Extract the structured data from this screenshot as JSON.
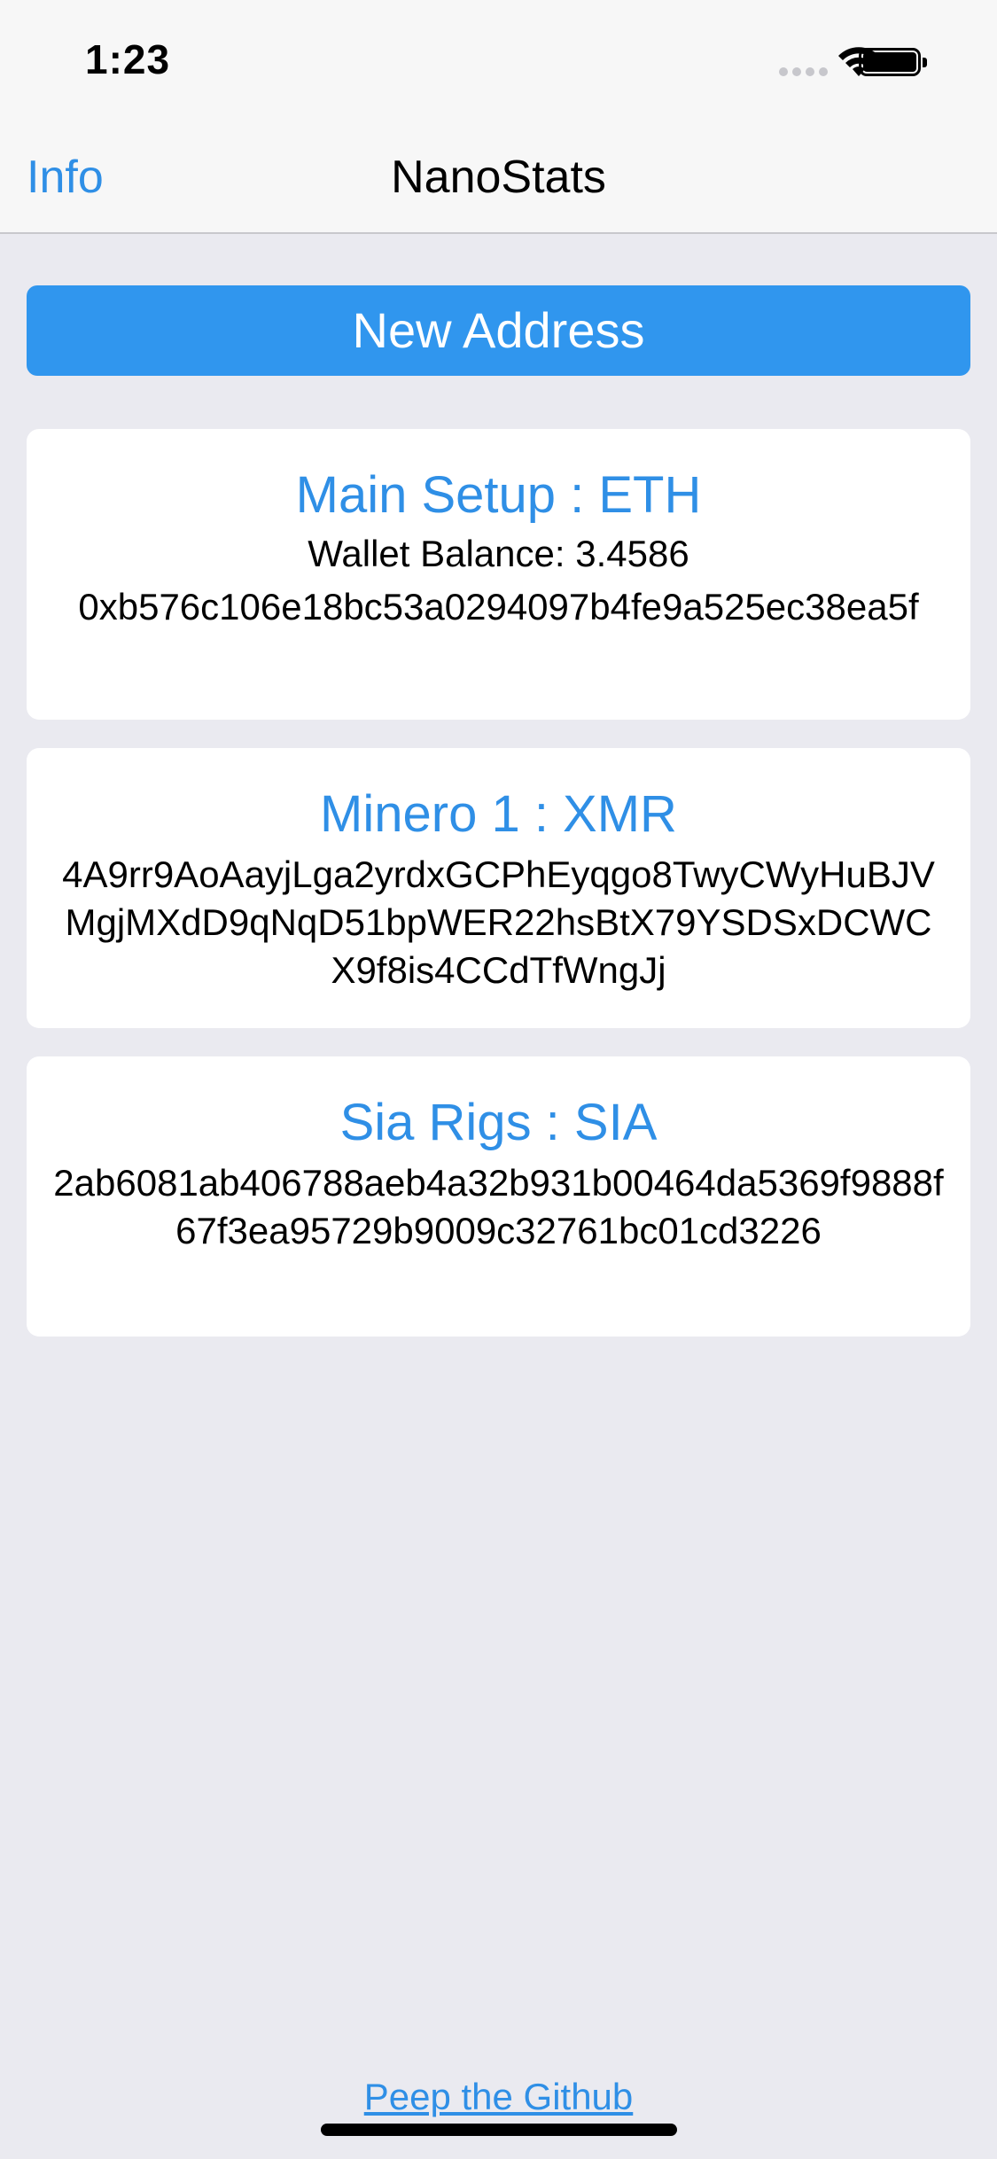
{
  "status_bar": {
    "time": "1:23",
    "icons": [
      "signal-icon",
      "wifi-icon",
      "battery-icon"
    ]
  },
  "nav": {
    "left_button": "Info",
    "title": "NanoStats"
  },
  "main": {
    "new_address_label": "New Address",
    "wallets": [
      {
        "title": "Main Setup : ETH",
        "balance": "Wallet Balance: 3.4586",
        "address": "0xb576c106e18bc53a0294097b4fe9a525ec38ea5f"
      },
      {
        "title": "Minero 1 : XMR",
        "address": "4A9rr9AoAayjLga2yrdxGCPhEyqgo8TwyCWyHuBJVMgjMXdD9qNqD51bpWER22hsBtX79YSDSxDCWCX9f8is4CCdTfWngJj"
      },
      {
        "title": "Sia Rigs : SIA",
        "address": "2ab6081ab406788aeb4a32b931b00464da5369f9888f67f3ea95729b9009c32761bc01cd3226"
      }
    ]
  },
  "footer": {
    "link_label": "Peep the Github"
  },
  "colors": {
    "accent": "#2F8FE6",
    "button": "#3096EE",
    "background": "#EAEAF0"
  }
}
